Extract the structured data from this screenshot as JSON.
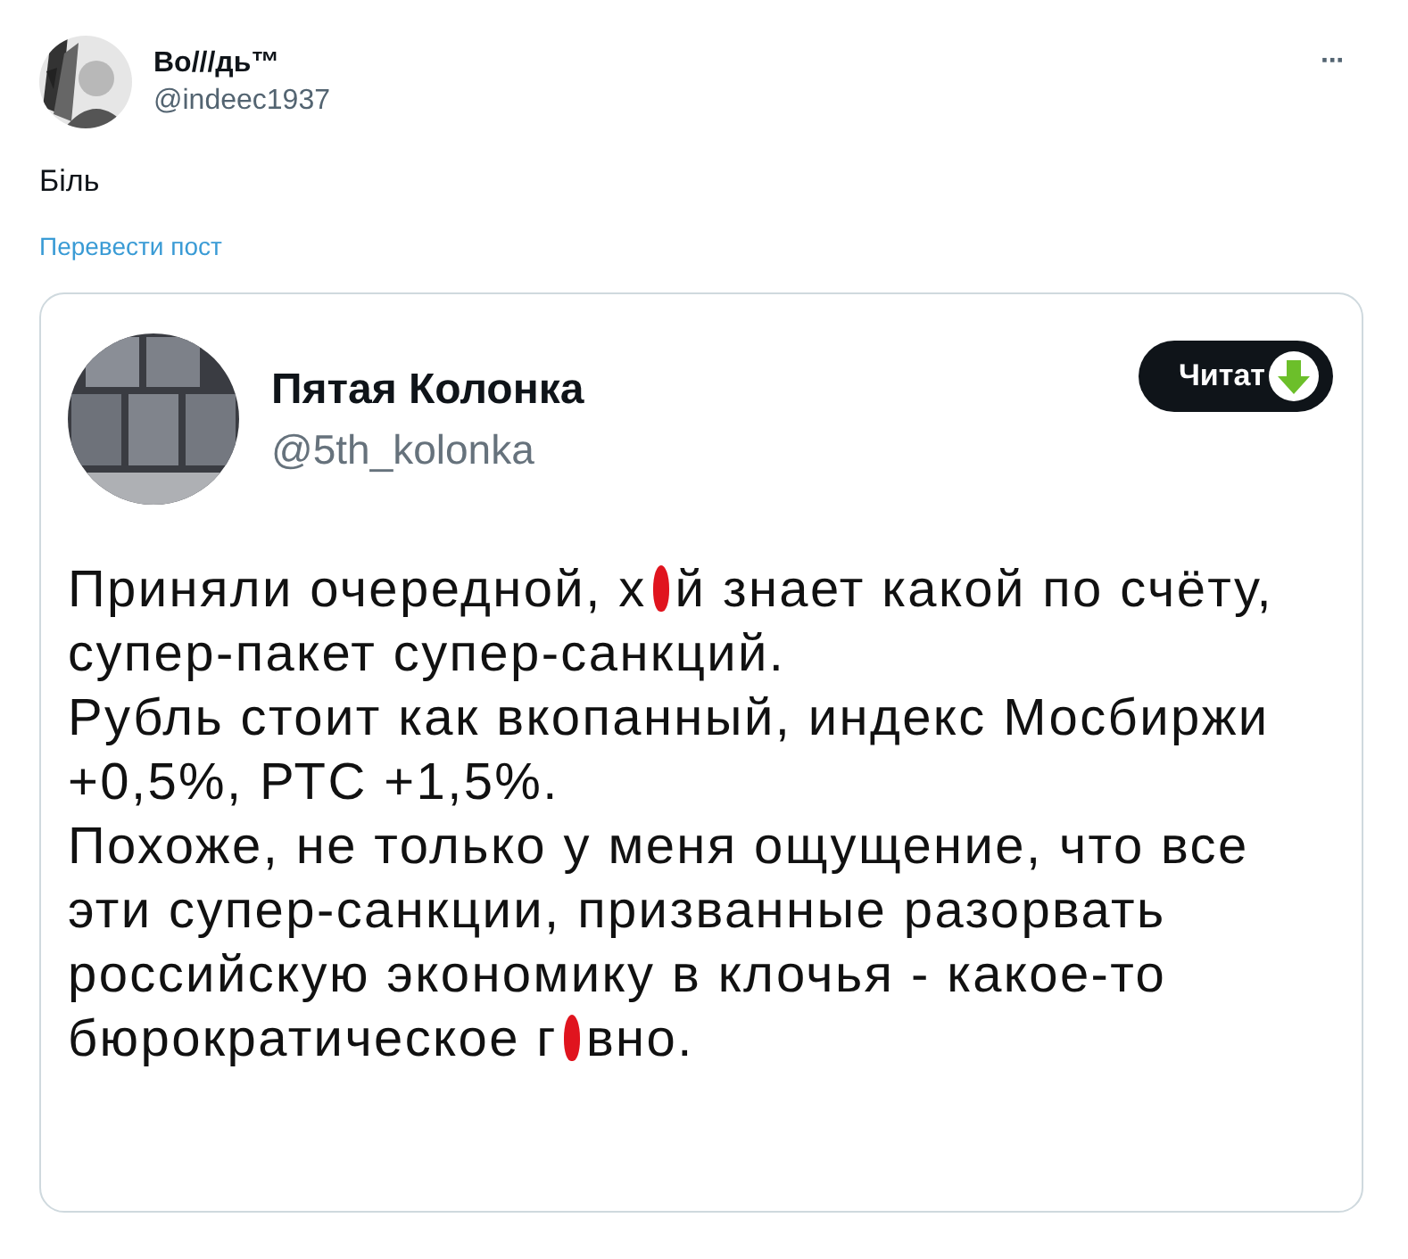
{
  "post": {
    "author": {
      "name": "Во///дь™",
      "handle": "@indeec1937"
    },
    "more": "···",
    "text": "Біль",
    "translate_link": "Перевести пост"
  },
  "quoted_screenshot": {
    "author": {
      "name": "Пятая Колонка",
      "handle": "@5th_kolonka"
    },
    "button": "Читат",
    "paragraphs": [
      {
        "parts": [
          {
            "kind": "text",
            "text": "Приняли очередной, х"
          },
          {
            "kind": "censor_mark"
          },
          {
            "kind": "text",
            "text": "й знает какой по счёту, супер-пакет супер-санкций."
          }
        ]
      },
      {
        "parts": [
          {
            "kind": "text",
            "text": "Рубль стоит как вкопанный, индекс Мосбиржи +0,5%, РТС +1,5%."
          }
        ]
      },
      {
        "parts": [
          {
            "kind": "text",
            "text": "Похоже, не только у меня ощущение, что все эти супер-санкции, призванные разорвать российскую экономику в клочья - какое-то бюрократическое г"
          },
          {
            "kind": "censor_mark"
          },
          {
            "kind": "text",
            "text": "вно."
          }
        ]
      }
    ]
  }
}
